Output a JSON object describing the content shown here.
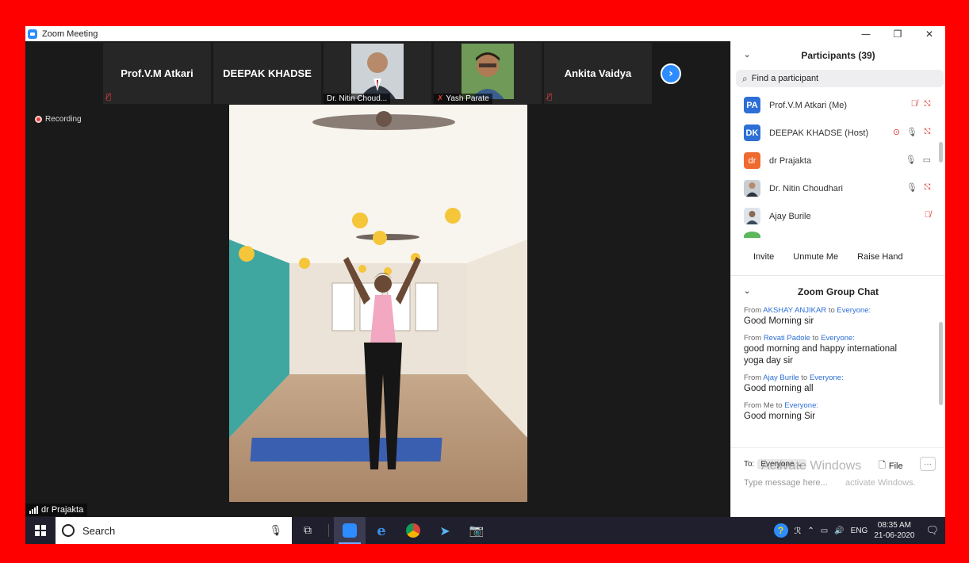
{
  "window": {
    "title": "Zoom Meeting",
    "minimize": "—",
    "restore": "❐",
    "close": "✕"
  },
  "thumbnails": [
    {
      "name": "Prof.V.M Atkari",
      "kind": "name"
    },
    {
      "name": "DEEPAK KHADSE",
      "kind": "name"
    },
    {
      "name": "Dr. Nitin Choud...",
      "kind": "photo"
    },
    {
      "name": "Yash Parate",
      "kind": "photo"
    },
    {
      "name": "Ankita Vaidya",
      "kind": "name"
    }
  ],
  "recording_label": "Recording",
  "active_speaker": "dr Prajakta",
  "participants": {
    "title": "Participants (39)",
    "search_placeholder": "Find a participant",
    "list": [
      {
        "initials": "PA",
        "name": "Prof.V.M Atkari (Me)",
        "color": "#2d6fd6"
      },
      {
        "initials": "DK",
        "name": "DEEPAK KHADSE (Host)",
        "color": "#2d6fd6"
      },
      {
        "initials": "dr",
        "name": "dr Prajakta",
        "color": "#ef6a2f"
      },
      {
        "initials": "",
        "name": "Dr. Nitin Choudhari",
        "color": "#8a8a8a"
      },
      {
        "initials": "",
        "name": "Ajay Burile",
        "color": "#9aa5b0"
      }
    ],
    "buttons": {
      "invite": "Invite",
      "unmute": "Unmute Me",
      "raise_hand": "Raise Hand"
    }
  },
  "chat": {
    "title": "Zoom Group Chat",
    "messages": [
      {
        "from": "AKSHAY ANJIKAR",
        "to": "Everyone:",
        "text": "Good Morning sir"
      },
      {
        "from": "Revati Padole",
        "to": "Everyone:",
        "text": "good morning  and happy international yoga day  sir"
      },
      {
        "from": "Ajay Burile",
        "to": "Everyone:",
        "text": "Good morning all"
      },
      {
        "from": "Me",
        "to": "Everyone:",
        "text": "Good morning Sir"
      }
    ],
    "from_word": "From",
    "to_word": "to",
    "to_label": "To:",
    "recipient": "Everyone",
    "file_label": "File",
    "more_label": "···",
    "placeholder": "Type message here...",
    "watermark_1": "Activate Windows",
    "watermark_2": "activate Windows."
  },
  "taskbar": {
    "search_label": "Search",
    "language": "ENG",
    "time": "08:35 AM",
    "date": "21-06-2020"
  },
  "colors": {
    "zoom_blue": "#2d8cff",
    "mute_red": "#e0403a",
    "frame_red": "#ff0000"
  }
}
